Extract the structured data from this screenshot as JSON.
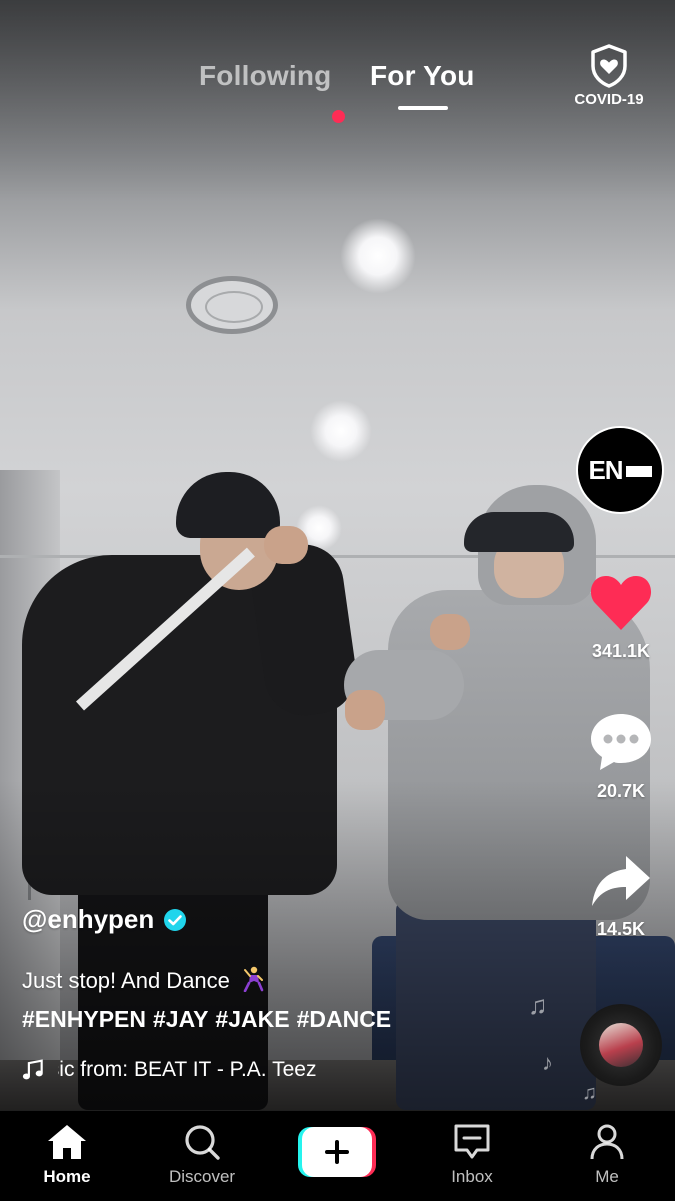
{
  "top_tabs": {
    "following": "Following",
    "for_you": "For You",
    "covid_label": "COVID-19"
  },
  "creator": {
    "avatar_text": "EN",
    "username": "@enhypen"
  },
  "actions": {
    "likes": "341.1K",
    "comments": "20.7K",
    "shares": "14.5K"
  },
  "caption": {
    "text": "Just stop! And Dance",
    "hashtags": [
      "#ENHYPEN",
      "#JAY",
      "#JAKE",
      "#DANCE"
    ]
  },
  "music": {
    "text": "Music from: BEAT IT - P.A. Teez"
  },
  "bottom_nav": {
    "home": "Home",
    "discover": "Discover",
    "inbox": "Inbox",
    "me": "Me"
  },
  "colors": {
    "like_red": "#fe2c55",
    "accent_cyan": "#25f4ee",
    "verified_blue": "#20d5ec"
  }
}
